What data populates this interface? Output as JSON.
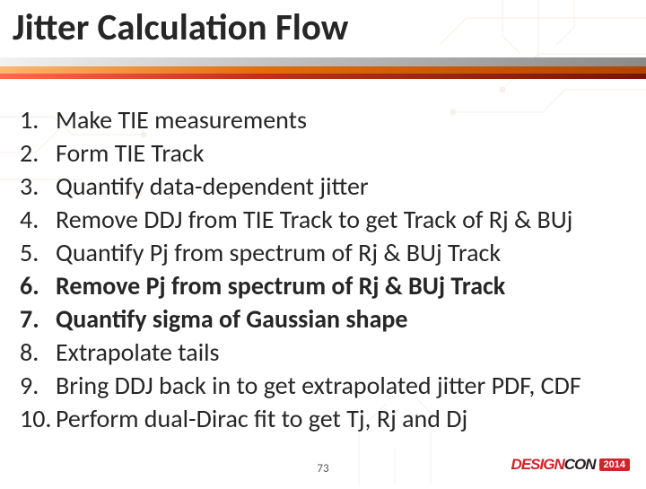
{
  "title": "Jitter Calculation Flow",
  "steps": [
    {
      "text": "Make TIE measurements",
      "bold": false
    },
    {
      "text": "Form TIE Track",
      "bold": false
    },
    {
      "text": "Quantify data-dependent jitter",
      "bold": false
    },
    {
      "text": "Remove DDJ from TIE Track to get Track of Rj & BUj",
      "bold": false
    },
    {
      "text": "Quantify Pj from spectrum of Rj & BUj Track",
      "bold": false
    },
    {
      "text": "Remove Pj from spectrum of Rj & BUj Track",
      "bold": true
    },
    {
      "text": "Quantify sigma of Gaussian shape",
      "bold": true
    },
    {
      "text": "Extrapolate tails",
      "bold": false
    },
    {
      "text": "Bring DDJ back in to get extrapolated jitter PDF, CDF",
      "bold": false
    },
    {
      "text": "Perform dual-Dirac fit to get Tj, Rj and Dj",
      "bold": false
    }
  ],
  "page_number": "73",
  "logo": {
    "part_a": "DESIGN",
    "part_b": "CON",
    "year": "2014"
  }
}
